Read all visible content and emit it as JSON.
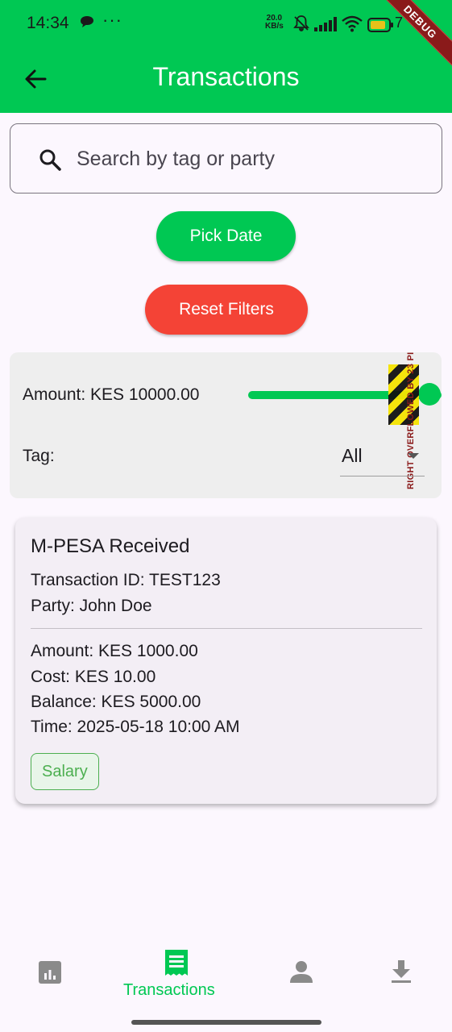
{
  "status_bar": {
    "time": "14:34",
    "dots": "···",
    "net_speed_value": "20.0",
    "net_speed_unit": "KB/s",
    "battery_text": "7"
  },
  "debug_banner": "DEBUG",
  "header": {
    "title": "Transactions"
  },
  "search": {
    "placeholder": "Search by tag or party",
    "value": ""
  },
  "buttons": {
    "pick_date": "Pick Date",
    "reset_filters": "Reset Filters"
  },
  "filters": {
    "amount_label": "Amount: KES 10000.00",
    "amount_slider_fraction": 1.0,
    "tag_label": "Tag:",
    "tag_selected": "All",
    "overflow_warning": "RIGHT OVERFLOWED BY 23 PIXELS"
  },
  "transactions": [
    {
      "title": "M-PESA Received",
      "transaction_id": "Transaction ID: TEST123",
      "party": "Party: John Doe",
      "amount": "Amount: KES 1000.00",
      "cost": "Cost: KES 10.00",
      "balance": "Balance: KES 5000.00",
      "time": "Time: 2025-05-18 10:00 AM",
      "tag": "Salary"
    }
  ],
  "bottom_nav": {
    "items": [
      {
        "icon": "analytics-icon",
        "label": ""
      },
      {
        "icon": "receipt-icon",
        "label": "Transactions",
        "active": true
      },
      {
        "icon": "person-icon",
        "label": ""
      },
      {
        "icon": "download-icon",
        "label": ""
      }
    ]
  },
  "colors": {
    "primary_green": "#00C853",
    "reset_red": "#F44336",
    "chip_green": "#4CAF50",
    "inactive_icon": "#8a8a8a"
  }
}
